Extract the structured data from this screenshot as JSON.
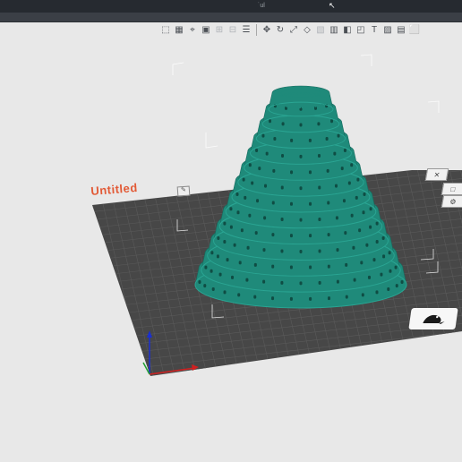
{
  "window": {
    "title": "˙ul"
  },
  "toolbar": {
    "icons": [
      "view-cube-icon",
      "grid-icon",
      "perspective-icon",
      "image-icon",
      "arrange-icon",
      "layout-icon",
      "layers-icon",
      "move-icon",
      "rotate-icon",
      "scale-icon",
      "cut-icon",
      "paint-icon",
      "support-icon",
      "place-on-face-icon",
      "measure-icon",
      "text-icon",
      "mesh-icon",
      "assemble-icon",
      "split-icon"
    ]
  },
  "plate": {
    "name": "Untitled"
  },
  "colors": {
    "model": "#1f8a7a",
    "plate": "#4a4a4a",
    "accent": "#e25a36"
  }
}
